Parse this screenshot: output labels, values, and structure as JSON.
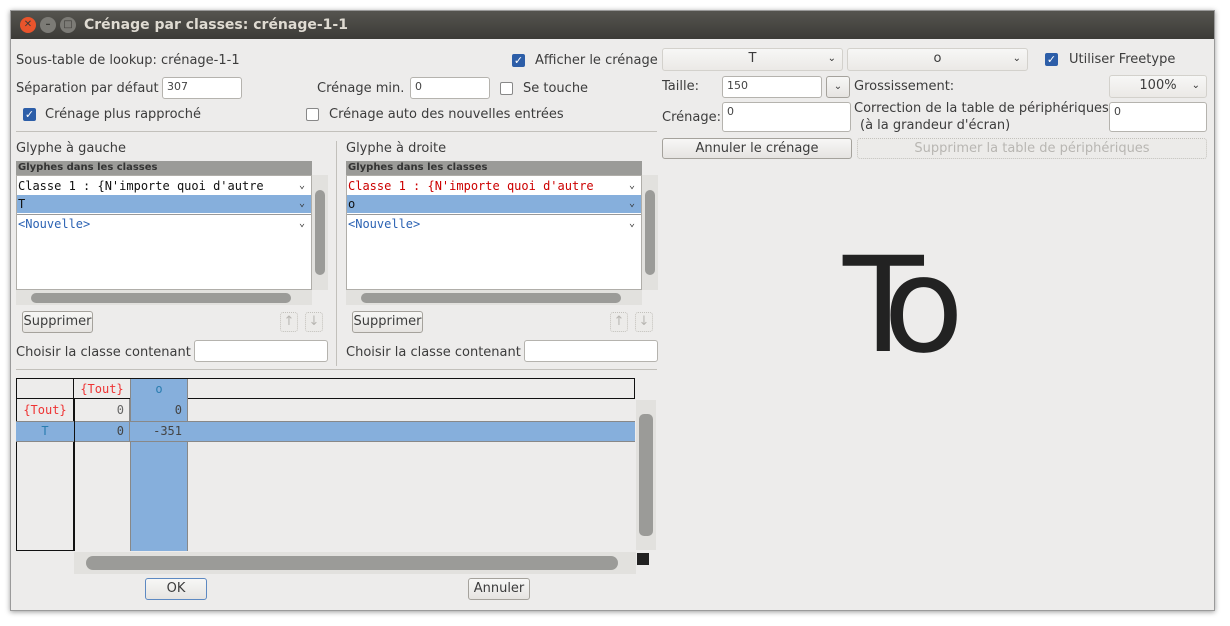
{
  "window": {
    "title": "Crénage par classes: crénage-1-1"
  },
  "top": {
    "lookup_label": "Sous-table de lookup: crénage-1-1",
    "show_kerning_label": "Afficher le crénage",
    "show_kerning": true,
    "default_sep_label": "Séparation par défaut :",
    "default_sep": "307",
    "min_kern_label": "Crénage min. :",
    "min_kern": "0",
    "touch_label": "Se touche",
    "touch": false,
    "closer_label": "Crénage plus rapproché",
    "closer": true,
    "auto_label": "Crénage auto des nouvelles entrées",
    "auto": false
  },
  "left": {
    "title": "Glyphe à gauche",
    "header": "Glyphes dans les classes",
    "items": [
      "Classe 1 : {N'importe quoi d'autre",
      "T",
      "<Nouvelle>"
    ],
    "delete": "Supprimer",
    "choose_label": "Choisir la classe contenant :",
    "choose_value": ""
  },
  "right": {
    "title": "Glyphe à droite",
    "header": "Glyphes dans les classes",
    "items": [
      "Classe 1 : {N'importe quoi d'autre",
      "o",
      "<Nouvelle>"
    ],
    "delete": "Supprimer",
    "choose_label": "Choisir la classe contenant :",
    "choose_value": ""
  },
  "matrix": {
    "col_headers": [
      "{Tout}",
      "o"
    ],
    "rows": [
      {
        "label": "{Tout}",
        "values": [
          "0",
          "0"
        ]
      },
      {
        "label": "T",
        "values": [
          "0",
          "-351"
        ]
      }
    ]
  },
  "buttons": {
    "ok": "OK",
    "cancel": "Annuler"
  },
  "preview": {
    "left_glyph": "T",
    "right_glyph": "o",
    "freetype_label": "Utiliser Freetype",
    "freetype": true,
    "size_label": "Taille:",
    "size": "150",
    "zoom_label": "Grossissement:",
    "zoom": "100%",
    "kern_label": "Crénage:",
    "kern": "0",
    "dev_label": "Correction de la table de périphériques:",
    "dev_label2": "(à la grandeur d'écran)",
    "dev": "0",
    "reset_kern": "Annuler le crénage",
    "delete_dev": "Supprimer la table de périphériques",
    "sample": "To"
  }
}
